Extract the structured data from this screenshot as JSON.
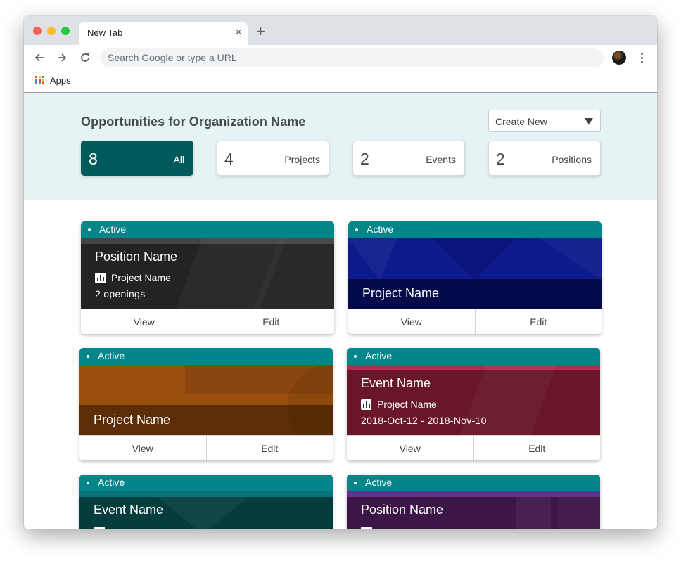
{
  "browser": {
    "tab_title": "New Tab",
    "tab_close": "×",
    "new_tab": "+",
    "address_placeholder": "Search Google or type a URL",
    "bookmarks": {
      "apps_label": "Apps"
    }
  },
  "header": {
    "title": "Opportunities for Organization Name",
    "create_new": "Create New"
  },
  "stats": [
    {
      "count": "8",
      "label": "All",
      "active": true
    },
    {
      "count": "4",
      "label": "Projects",
      "active": false
    },
    {
      "count": "2",
      "label": "Events",
      "active": false
    },
    {
      "count": "2",
      "label": "Positions",
      "active": false
    }
  ],
  "cards": [
    {
      "status": "Active",
      "title": "Position Name",
      "project": "Project Name",
      "meta": "2  openings",
      "view": "View",
      "edit": "Edit",
      "theme": "#232323"
    },
    {
      "status": "Active",
      "title": "Project Name",
      "view": "View",
      "edit": "Edit",
      "theme": "#0c1a8c"
    },
    {
      "status": "Active",
      "title": "Project Name",
      "view": "View",
      "edit": "Edit",
      "theme": "#9a4f10"
    },
    {
      "status": "Active",
      "title": "Event Name",
      "project": "Project Name",
      "meta": "2018-Oct-12 - 2018-Nov-10",
      "view": "View",
      "edit": "Edit",
      "theme": "#681628"
    },
    {
      "status": "Active",
      "title": "Event Name",
      "theme": "#053d3d"
    },
    {
      "status": "Active",
      "title": "Position Name",
      "theme": "#3d1648"
    }
  ],
  "colors": {
    "accent": "#005a5b",
    "status_bar": "#03868a",
    "hero_bg": "#e6f3f4"
  }
}
